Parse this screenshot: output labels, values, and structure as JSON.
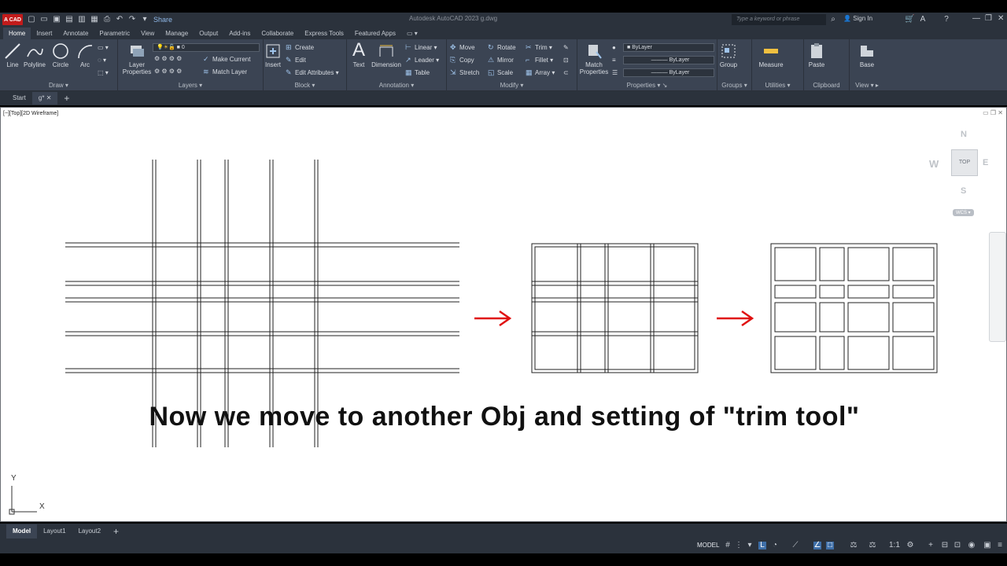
{
  "app": {
    "logo_text": "A CAD",
    "title": "Autodesk AutoCAD 2023    g.dwg",
    "share_label": "Share",
    "search_placeholder": "Type a keyword or phrase",
    "sign_in": "Sign In"
  },
  "ribbon_tabs": [
    "Home",
    "Insert",
    "Annotate",
    "Parametric",
    "View",
    "Manage",
    "Output",
    "Add-ins",
    "Collaborate",
    "Express Tools",
    "Featured Apps"
  ],
  "active_ribbon_tab": "Home",
  "draw_panel": {
    "title": "Draw",
    "tools": [
      "Line",
      "Polyline",
      "Circle",
      "Arc"
    ]
  },
  "layers_panel": {
    "title": "Layers",
    "layer_properties": "Layer Properties",
    "current_layer": "0",
    "make_current": "Make Current",
    "match_layer": "Match Layer"
  },
  "block_panel": {
    "title": "Block",
    "insert": "Insert",
    "create": "Create",
    "edit": "Edit",
    "edit_attributes": "Edit Attributes"
  },
  "annotation_panel": {
    "title": "Annotation",
    "text": "Text",
    "dimension": "Dimension",
    "linear": "Linear",
    "leader": "Leader",
    "table": "Table"
  },
  "modify_panel": {
    "title": "Modify",
    "move": "Move",
    "rotate": "Rotate",
    "trim": "Trim",
    "copy": "Copy",
    "mirror": "Mirror",
    "fillet": "Fillet",
    "stretch": "Stretch",
    "scale": "Scale",
    "array": "Array"
  },
  "properties_panel": {
    "title": "Properties",
    "match_properties": "Match Properties",
    "color": "ByLayer",
    "linetype": "ByLayer",
    "lineweight": "ByLayer"
  },
  "groups_panel": {
    "title": "Groups",
    "group": "Group"
  },
  "utilities_panel": {
    "title": "Utilities",
    "measure": "Measure"
  },
  "clipboard_panel": {
    "title": "Clipboard",
    "paste": "Paste"
  },
  "view_panel": {
    "title": "View",
    "base": "Base"
  },
  "file_tabs": {
    "start": "Start",
    "current": "g*"
  },
  "viewport": {
    "label": "[−][Top][2D Wireframe]"
  },
  "view_cube": {
    "north": "N",
    "south": "S",
    "east": "E",
    "west": "W",
    "face": "TOP",
    "wcs": "WCS"
  },
  "ucs": {
    "x": "X",
    "y": "Y"
  },
  "caption": "Now we move to another Obj and setting of \"trim tool\"",
  "layout_tabs": [
    "Model",
    "Layout1",
    "Layout2"
  ],
  "active_layout_tab": "Model",
  "status": {
    "model": "MODEL"
  },
  "colors": {
    "arrow": "#e01010",
    "accent": "#3f6fa8",
    "logo": "#c21b1b"
  }
}
